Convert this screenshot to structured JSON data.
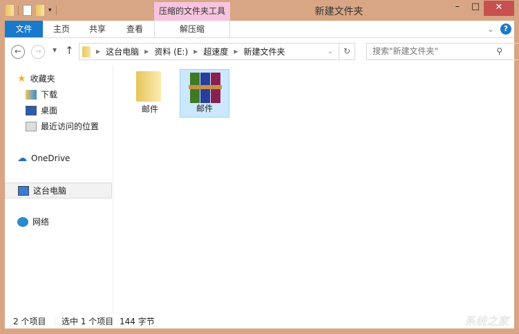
{
  "window": {
    "title": "新建文件夹",
    "context_tab": "压缩的文件夹工具",
    "minimize": "–",
    "maximize": "□",
    "close": "✕"
  },
  "ribbon": {
    "tabs": [
      "文件",
      "主页",
      "共享",
      "查看"
    ],
    "context_tab": "解压缩",
    "help": "?",
    "expand": "⌄"
  },
  "address": {
    "crumbs": [
      "这台电脑",
      "资料 (E:)",
      "超速度",
      "新建文件夹"
    ],
    "search_placeholder": "搜索\"新建文件夹\""
  },
  "nav": {
    "favorites": "收藏夹",
    "downloads": "下载",
    "desktop": "桌面",
    "recent": "最近访问的位置",
    "onedrive": "OneDrive",
    "thispc": "这台电脑",
    "network": "网络"
  },
  "files": [
    {
      "name": "邮件",
      "type": "folder"
    },
    {
      "name": "邮件",
      "type": "rar",
      "selected": true
    }
  ],
  "status": {
    "count": "2 个项目",
    "selection": "选中 1 个项目",
    "size": "144 字节"
  },
  "watermark": "系统之家"
}
